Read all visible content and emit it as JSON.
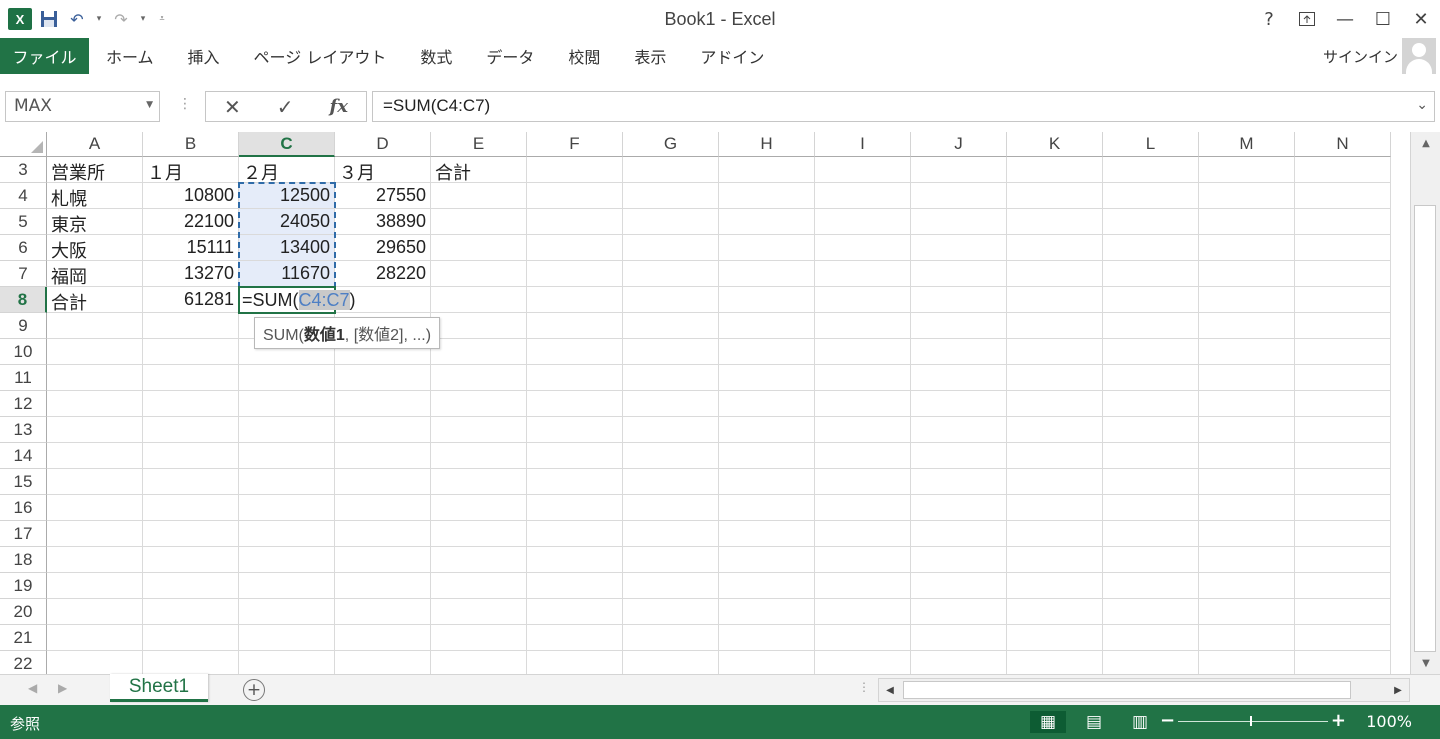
{
  "title_bar": {
    "title": "Book1 - Excel",
    "app_logo": "X",
    "help": "?"
  },
  "ribbon": {
    "file_tab": "ファイル",
    "tabs": [
      "ホーム",
      "挿入",
      "ページ レイアウト",
      "数式",
      "データ",
      "校閲",
      "表示",
      "アドイン"
    ],
    "signin": "サインイン"
  },
  "formula_bar": {
    "name_box": "MAX",
    "formula": "=SUM(C4:C7)"
  },
  "columns": [
    "A",
    "B",
    "C",
    "D",
    "E",
    "F",
    "G",
    "H",
    "I",
    "J",
    "K",
    "L",
    "M",
    "N"
  ],
  "selected_column": "C",
  "selected_row": "8",
  "rows": [
    {
      "num": "3",
      "cells": [
        "営業所",
        "１月",
        "２月",
        "３月",
        "合計"
      ]
    },
    {
      "num": "4",
      "cells": [
        "札幌",
        "10800",
        "12500",
        "27550",
        ""
      ]
    },
    {
      "num": "5",
      "cells": [
        "東京",
        "22100",
        "24050",
        "38890",
        ""
      ]
    },
    {
      "num": "6",
      "cells": [
        "大阪",
        "15111",
        "13400",
        "29650",
        ""
      ]
    },
    {
      "num": "7",
      "cells": [
        "福岡",
        "13270",
        "11670",
        "28220",
        ""
      ]
    },
    {
      "num": "8",
      "cells": [
        "合計",
        "61281",
        "",
        "",
        ""
      ]
    },
    {
      "num": "9",
      "cells": []
    },
    {
      "num": "10",
      "cells": []
    },
    {
      "num": "11",
      "cells": []
    },
    {
      "num": "12",
      "cells": []
    },
    {
      "num": "13",
      "cells": []
    },
    {
      "num": "14",
      "cells": []
    },
    {
      "num": "15",
      "cells": []
    },
    {
      "num": "16",
      "cells": []
    },
    {
      "num": "17",
      "cells": []
    },
    {
      "num": "18",
      "cells": []
    },
    {
      "num": "19",
      "cells": []
    },
    {
      "num": "20",
      "cells": []
    },
    {
      "num": "21",
      "cells": []
    },
    {
      "num": "22",
      "cells": []
    }
  ],
  "editing": {
    "prefix": "=SUM(",
    "reference": "C4:C7",
    "suffix": ")"
  },
  "tooltip": {
    "fn": "SUM(",
    "arg1": "数値1",
    "rest": ", [数値2], ...)"
  },
  "sheet": {
    "tab": "Sheet1",
    "add_icon": "plus-circle-icon"
  },
  "status_bar": {
    "mode": "参照",
    "zoom": "100%"
  },
  "colors": {
    "accent": "#217346",
    "range_marquee": "#2f6ba8",
    "range_fill": "#e5ecf9"
  }
}
